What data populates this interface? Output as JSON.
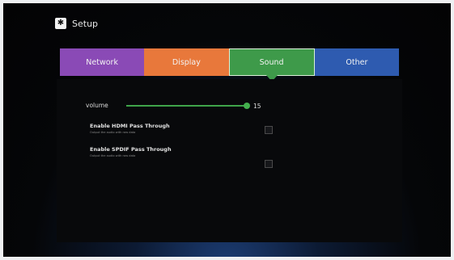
{
  "header": {
    "title": "Setup",
    "icon": "settings-icon"
  },
  "tabs": [
    {
      "label": "Network",
      "color": "#8a4ab6"
    },
    {
      "label": "Display",
      "color": "#e8783b"
    },
    {
      "label": "Sound",
      "color": "#3e9a4a",
      "selected": true
    },
    {
      "label": "Other",
      "color": "#2e5bb0"
    }
  ],
  "sound": {
    "volume_label": "volume",
    "volume_value": "15",
    "volume_fraction": 1.0,
    "options": [
      {
        "title": "Enable HDMI Pass Through",
        "subtitle": "Output the audio with raw data",
        "checked": false
      },
      {
        "title": "Enable SPDIF Pass Through",
        "subtitle": "Output the audio with raw data",
        "checked": false
      }
    ]
  }
}
